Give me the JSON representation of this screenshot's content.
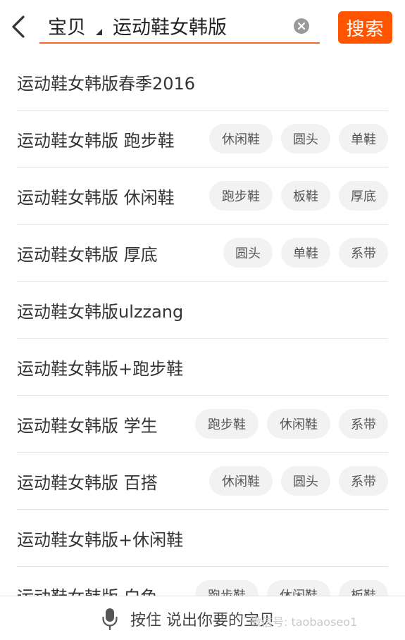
{
  "search": {
    "scope_label": "宝贝",
    "query": "运动鞋女韩版",
    "button_label": "搜索"
  },
  "colors": {
    "accent": "#ff5500",
    "underline": "#f0682a",
    "tag_bg": "#f2f2f2"
  },
  "icons": {
    "back": "chevron-left-icon",
    "clear": "clear-circle-icon",
    "voice": "microphone-icon"
  },
  "suggestions": [
    {
      "text": "运动鞋女韩版春季2016",
      "tags": []
    },
    {
      "text": "运动鞋女韩版 跑步鞋",
      "tags": [
        "休闲鞋",
        "圆头",
        "单鞋"
      ]
    },
    {
      "text": "运动鞋女韩版 休闲鞋",
      "tags": [
        "跑步鞋",
        "板鞋",
        "厚底"
      ]
    },
    {
      "text": "运动鞋女韩版 厚底",
      "tags": [
        "圆头",
        "单鞋",
        "系带"
      ]
    },
    {
      "text": "运动鞋女韩版ulzzang",
      "tags": []
    },
    {
      "text": "运动鞋女韩版+跑步鞋",
      "tags": []
    },
    {
      "text": "运动鞋女韩版 学生",
      "tags": [
        "跑步鞋",
        "休闲鞋",
        "系带"
      ]
    },
    {
      "text": "运动鞋女韩版 百搭",
      "tags": [
        "休闲鞋",
        "圆头",
        "系带"
      ]
    },
    {
      "text": "运动鞋女韩版+休闲鞋",
      "tags": []
    },
    {
      "text": "运动鞋女韩版 白色",
      "tags": [
        "跑步鞋",
        "休闲鞋",
        "板鞋"
      ]
    }
  ],
  "voice": {
    "label": "按住 说出你要的宝贝"
  },
  "watermark": "微信号: taobaoseo1"
}
